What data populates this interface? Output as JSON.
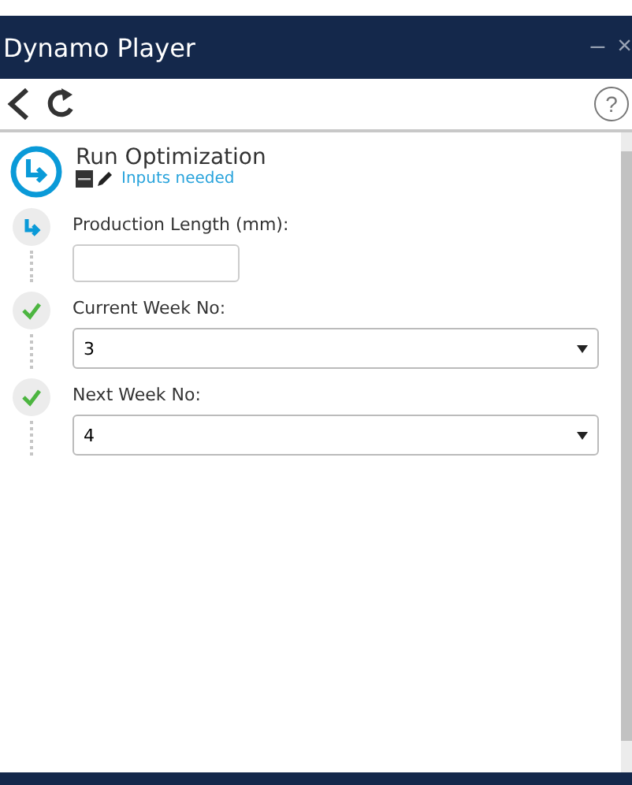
{
  "window": {
    "title": "Dynamo Player",
    "minimize": "–",
    "close": "×"
  },
  "toolbar": {
    "help": "?"
  },
  "script": {
    "name": "Run Optimization",
    "status": "Inputs needed"
  },
  "inputs": [
    {
      "label": "Production Length (mm):",
      "kind": "text",
      "done": false
    },
    {
      "label": "Current Week No:",
      "kind": "select",
      "value": "3",
      "done": true
    },
    {
      "label": "Next Week No:",
      "kind": "select",
      "value": "4",
      "done": true
    }
  ]
}
